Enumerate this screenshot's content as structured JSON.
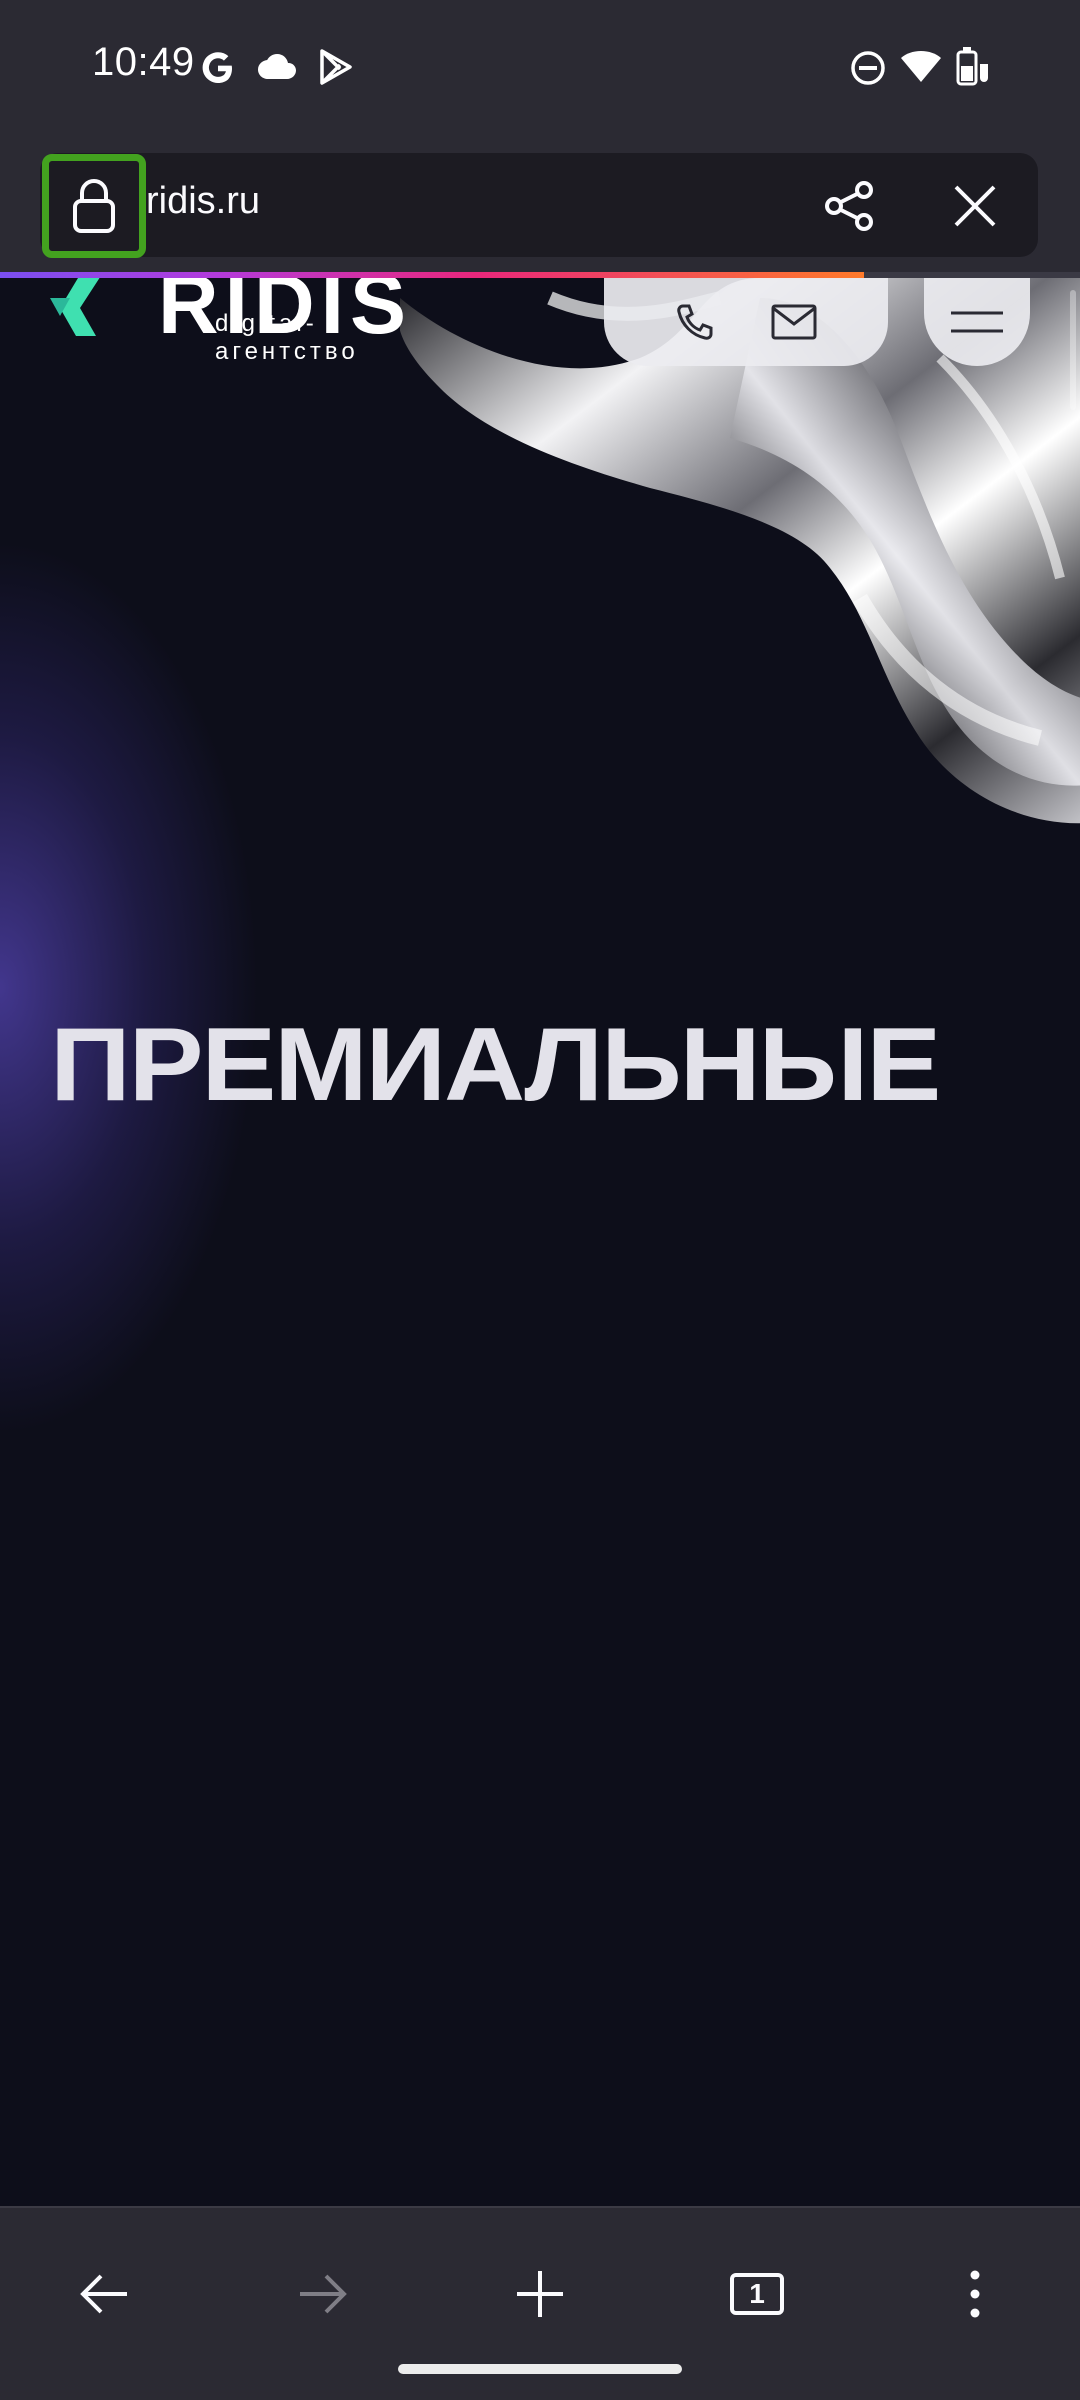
{
  "status_bar": {
    "time": "10:49",
    "left_icons": [
      "google-icon",
      "cloud-icon",
      "play-store-icon"
    ],
    "right_icons": [
      "do-not-disturb-icon",
      "wifi-icon",
      "battery-charging-icon"
    ]
  },
  "browser": {
    "url": "ridis.ru",
    "lock_icon": "lock-icon",
    "share_icon": "share-icon",
    "close_icon": "close-icon",
    "load_progress": 0.8,
    "highlight_color": "#43a21f"
  },
  "site": {
    "logo_text": "RIDIS",
    "logo_sub": "digital-агентство",
    "accent_color": "#3fe0b0",
    "contact_icons": [
      "phone-icon",
      "mail-icon"
    ],
    "menu_icon": "hamburger-menu-icon",
    "headline": "ПРЕМИАЛЬНЫЕ"
  },
  "toolbar": {
    "buttons": [
      "back-icon",
      "forward-icon",
      "new-tab-icon",
      "tabs-icon",
      "more-icon"
    ],
    "tab_count": "1"
  }
}
